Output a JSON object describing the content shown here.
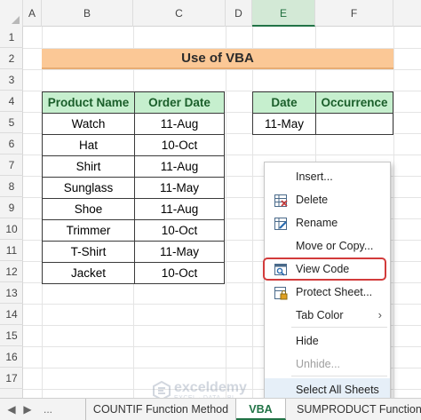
{
  "columns": [
    "A",
    "B",
    "C",
    "D",
    "E",
    "F"
  ],
  "selected_column": "E",
  "rows": [
    "1",
    "2",
    "3",
    "4",
    "5",
    "6",
    "7",
    "8",
    "9",
    "10",
    "11",
    "12",
    "13",
    "14",
    "15",
    "16",
    "17"
  ],
  "title": "Use of VBA",
  "product_table": {
    "headers": [
      "Product Name",
      "Order Date"
    ],
    "rows": [
      [
        "Watch",
        "11-Aug"
      ],
      [
        "Hat",
        "10-Oct"
      ],
      [
        "Shirt",
        "11-Aug"
      ],
      [
        "Sunglass",
        "11-May"
      ],
      [
        "Shoe",
        "11-Aug"
      ],
      [
        "Trimmer",
        "10-Oct"
      ],
      [
        "T-Shirt",
        "11-May"
      ],
      [
        "Jacket",
        "10-Oct"
      ]
    ]
  },
  "occurrence_table": {
    "headers": [
      "Date",
      "Occurrence"
    ],
    "rows": [
      [
        "11-May",
        ""
      ]
    ]
  },
  "context_menu": {
    "items": [
      {
        "key": "insert",
        "label": "Insert...",
        "icon": "none",
        "disabled": false
      },
      {
        "key": "delete",
        "label": "Delete",
        "icon": "delete-sheet-icon",
        "disabled": false
      },
      {
        "key": "rename",
        "label": "Rename",
        "icon": "rename-icon",
        "disabled": false
      },
      {
        "key": "move",
        "label": "Move or Copy...",
        "icon": "none",
        "disabled": false
      },
      {
        "key": "viewcode",
        "label": "View Code",
        "icon": "view-code-icon",
        "disabled": false,
        "highlighted": true
      },
      {
        "key": "protect",
        "label": "Protect Sheet...",
        "icon": "protect-sheet-icon",
        "disabled": false
      },
      {
        "key": "tabcolor",
        "label": "Tab Color",
        "icon": "none",
        "disabled": false,
        "submenu": true
      },
      {
        "key": "hide",
        "label": "Hide",
        "icon": "none",
        "disabled": false
      },
      {
        "key": "unhide",
        "label": "Unhide...",
        "icon": "none",
        "disabled": true
      },
      {
        "key": "selectall",
        "label": "Select All Sheets",
        "icon": "none",
        "disabled": false
      }
    ],
    "highlight_color": "#d23b3b"
  },
  "sheet_tabs": {
    "tabs": [
      "COUNTIF Function Method",
      "VBA",
      "SUMPRODUCT Function M"
    ],
    "active": "VBA",
    "nav_left": "◀",
    "nav_right": "▶",
    "ellipsis": "..."
  },
  "watermark": {
    "brand": "exceldemy",
    "tagline": "EXCEL · DATA · BI"
  },
  "colors": {
    "title_fill": "#fbc896",
    "header_fill": "#c6efce",
    "header_text": "#1a5e2a",
    "excel_green": "#217346"
  }
}
